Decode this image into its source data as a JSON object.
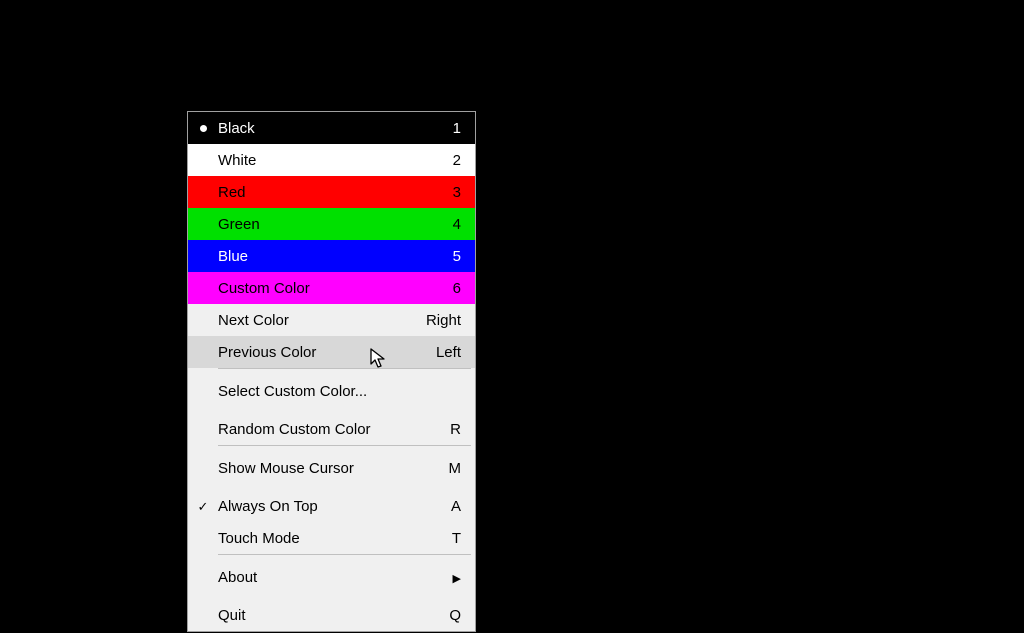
{
  "menu": {
    "colors": [
      {
        "label": "Black",
        "accel": "1",
        "rowClass": "row-black",
        "mark": "bullet"
      },
      {
        "label": "White",
        "accel": "2",
        "rowClass": "row-white",
        "mark": ""
      },
      {
        "label": "Red",
        "accel": "3",
        "rowClass": "row-red",
        "mark": ""
      },
      {
        "label": "Green",
        "accel": "4",
        "rowClass": "row-green",
        "mark": ""
      },
      {
        "label": "Blue",
        "accel": "5",
        "rowClass": "row-blue",
        "mark": ""
      },
      {
        "label": "Custom Color",
        "accel": "6",
        "rowClass": "row-magenta",
        "mark": ""
      }
    ],
    "nav": [
      {
        "label": "Next Color",
        "accel": "Right",
        "rowClass": "row-default"
      },
      {
        "label": "Previous Color",
        "accel": "Left",
        "rowClass": "row-hover"
      }
    ],
    "custom": [
      {
        "label": "Select Custom Color...",
        "accel": "",
        "rowClass": "row-default"
      },
      {
        "label": "Random Custom Color",
        "accel": "R",
        "rowClass": "row-default"
      }
    ],
    "options": [
      {
        "label": "Show Mouse Cursor",
        "accel": "M",
        "rowClass": "row-default",
        "mark": ""
      },
      {
        "label": "Always On Top",
        "accel": "A",
        "rowClass": "row-default",
        "mark": "check"
      },
      {
        "label": "Touch Mode",
        "accel": "T",
        "rowClass": "row-default",
        "mark": ""
      }
    ],
    "footer": [
      {
        "label": "About",
        "accel": "",
        "rowClass": "row-default",
        "submenu": true
      },
      {
        "label": "Quit",
        "accel": "Q",
        "rowClass": "row-default",
        "submenu": false
      }
    ]
  }
}
